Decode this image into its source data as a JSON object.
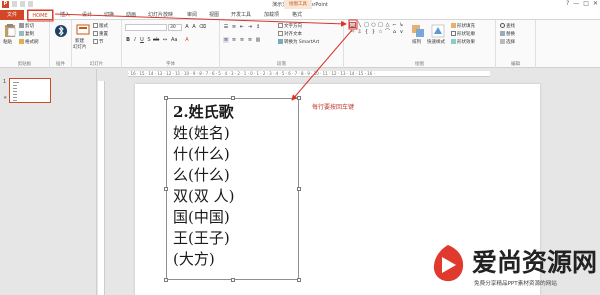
{
  "titlebar": {
    "doc_title": "演示文稿1 - PowerPoint",
    "app_letter": "P",
    "context_tab": "绘图工具",
    "window_buttons": [
      "?",
      "—",
      "□",
      "✕"
    ]
  },
  "tabs": {
    "file": "文件",
    "home": "HOME",
    "insert": "插入",
    "design": "设计",
    "transitions": "切换",
    "animations": "动画",
    "slideshow": "幻灯片放映",
    "review": "审阅",
    "view": "视图",
    "developer": "开发工具",
    "addins": "加载项",
    "format": "格式"
  },
  "ribbon": {
    "paste": "粘贴",
    "cut": "剪切",
    "copy": "复制",
    "format_painter": "格式刷",
    "clipboard_group": "剪贴板",
    "plugin_group": "插件",
    "new_slide": "新建",
    "new_slide_sub": "幻灯片",
    "layout": "版式",
    "reset": "重置",
    "section": "节",
    "slides_group": "幻灯片",
    "font_size": "30",
    "font_group": "字体",
    "text_direction": "文字方向",
    "align_text": "对齐文本",
    "convert_smartart": "转换为 SmartArt",
    "paragraph_group": "段落",
    "arrange": "排列",
    "quick_styles": "快速样式",
    "shape_fill": "形状填充",
    "shape_outline": "形状轮廓",
    "shape_effects": "形状效果",
    "drawing_group": "绘图",
    "find": "查找",
    "replace": "替换",
    "select": "选择",
    "editing_group": "编辑"
  },
  "shapes": [
    "▤",
    "╲",
    "□",
    "○",
    "□",
    "△",
    "⌐",
    "↳",
    "⇨",
    "⇩",
    "{",
    "}",
    "☆",
    "⌒",
    "⌂",
    "∨"
  ],
  "thumbnail": {
    "number": "1",
    "star": "★"
  },
  "ruler_text": "· 16 · 15 · 14 · 13 · 12 · 11 · 10 · 9 · 8 · 7 · 6 · 5 · 4 · 3 · 2 · 1 · 0 · 1 · 2 · 3 · 4 · 5 · 6 · 7 · 8 · 9 · 10 · 11 · 12 · 13 · 14 · 15 · 16 ·",
  "textbox": {
    "lines": [
      "2.姓氏歌",
      "姓(姓名)",
      "什(什么)",
      "么(什么)",
      "双(双 人)",
      "国(中国)",
      "王(王子)",
      "(大方)"
    ]
  },
  "annotation": "每行要按回车键",
  "watermark": {
    "title": "爱尚资源网",
    "subtitle": "免费分享精品PPT素材资源的网站"
  },
  "colors": {
    "accent": "#d24726",
    "annotation_red": "#c0392b"
  }
}
